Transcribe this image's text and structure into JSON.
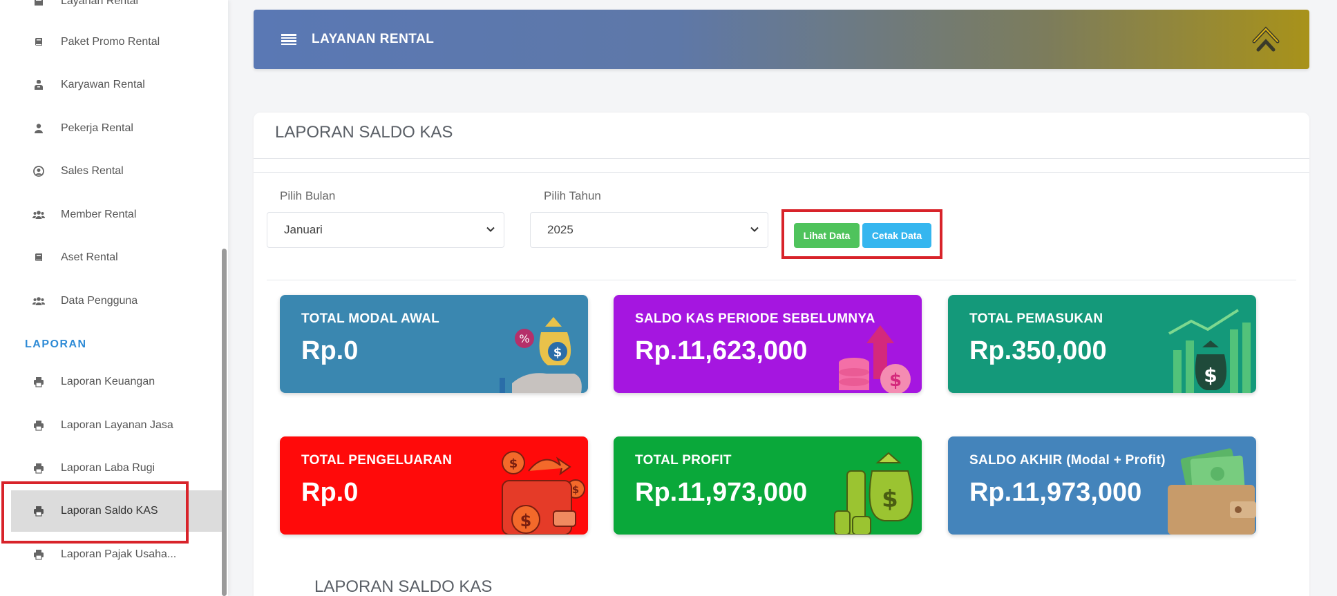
{
  "sidebar": {
    "items": [
      {
        "label": "Layanan Rental",
        "icon": "box-icon"
      },
      {
        "label": "Paket Promo Rental",
        "icon": "book-icon"
      },
      {
        "label": "Karyawan Rental",
        "icon": "user-tie-icon"
      },
      {
        "label": "Pekerja Rental",
        "icon": "user-icon"
      },
      {
        "label": "Sales Rental",
        "icon": "user-circle-icon"
      },
      {
        "label": "Member Rental",
        "icon": "users-icon"
      },
      {
        "label": "Aset Rental",
        "icon": "book-icon"
      },
      {
        "label": "Data Pengguna",
        "icon": "users-icon"
      }
    ],
    "section_label": "LAPORAN",
    "report_items": [
      {
        "label": "Laporan Keuangan",
        "icon": "print-icon"
      },
      {
        "label": "Laporan Layanan Jasa",
        "icon": "print-icon"
      },
      {
        "label": "Laporan Laba Rugi",
        "icon": "print-icon"
      },
      {
        "label": "Laporan Saldo KAS",
        "icon": "print-icon",
        "active": true
      },
      {
        "label": "Laporan Pajak Usaha...",
        "icon": "print-icon"
      }
    ]
  },
  "header": {
    "title": "LAYANAN RENTAL",
    "gradient_start": "#5a78b4",
    "gradient_end": "#a8921a"
  },
  "report": {
    "title": "LAPORAN SALDO KAS",
    "month_label": "Pilih Bulan",
    "month_value": "Januari",
    "year_label": "Pilih Tahun",
    "year_value": "2025",
    "view_button": "Lihat Data",
    "print_button": "Cetak Data",
    "bottom_title": "LAPORAN SALDO KAS"
  },
  "stats": [
    {
      "label": "TOTAL MODAL AWAL",
      "value": "Rp.0",
      "color": "#3a87b0"
    },
    {
      "label": "SALDO KAS PERIODE SEBELUMNYA",
      "value": "Rp.11,623,000",
      "color": "#a516e0"
    },
    {
      "label": "TOTAL PEMASUKAN",
      "value": "Rp.350,000",
      "color": "#14997a"
    },
    {
      "label": "TOTAL PENGELUARAN",
      "value": "Rp.0",
      "color": "#ff0a0a"
    },
    {
      "label": "TOTAL PROFIT",
      "value": "Rp.11,973,000",
      "color": "#0aa83a"
    },
    {
      "label": "SALDO AKHIR (Modal + Profit)",
      "value": "Rp.11,973,000",
      "color": "#4484bb"
    }
  ]
}
